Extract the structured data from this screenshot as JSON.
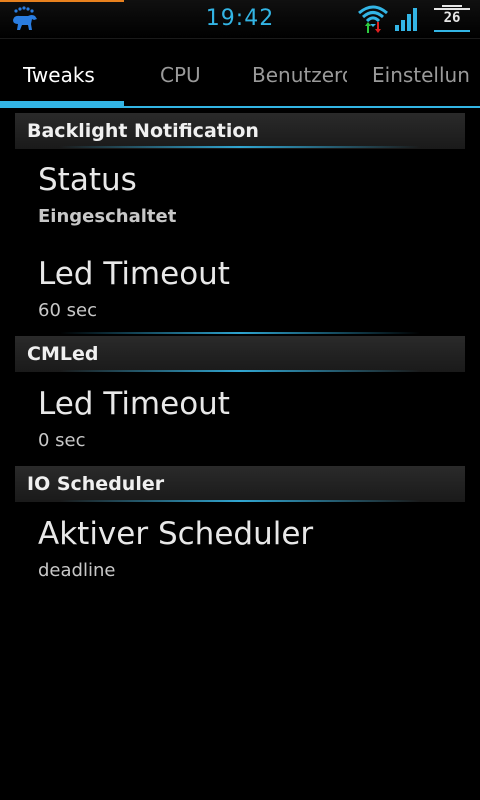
{
  "statusbar": {
    "time": "19:42",
    "battery_level": "26",
    "icons": [
      "notification-app-icon",
      "wifi-icon",
      "signal-icon",
      "battery-icon"
    ]
  },
  "tabs": [
    {
      "label": "Tweaks",
      "active": true
    },
    {
      "label": "CPU",
      "active": false
    },
    {
      "label": "Benutzerd",
      "active": false
    },
    {
      "label": "Einstellun",
      "active": false
    }
  ],
  "colors": {
    "accent": "#33b5e5",
    "progress": "#e8811e",
    "background": "#000000"
  },
  "sections": [
    {
      "header": "Backlight Notification",
      "items": [
        {
          "title": "Status",
          "summary": "Eingeschaltet"
        },
        {
          "title": "Led Timeout",
          "summary": "60 sec"
        }
      ]
    },
    {
      "header": "CMLed",
      "items": [
        {
          "title": "Led Timeout",
          "summary": "0 sec"
        }
      ]
    },
    {
      "header": "IO Scheduler",
      "items": [
        {
          "title": "Aktiver Scheduler",
          "summary": "deadline"
        }
      ]
    }
  ]
}
